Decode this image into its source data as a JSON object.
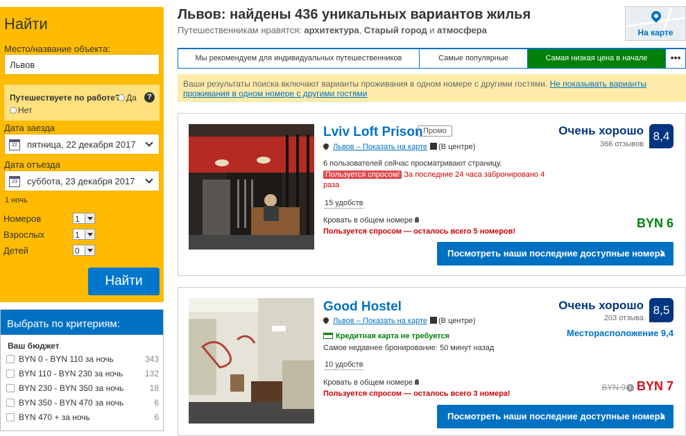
{
  "search": {
    "title": "Найти",
    "destination_label": "Место/название объекта:",
    "destination_value": "Львов",
    "business_trip_question": "Путешествуете по работе?",
    "business_trip_yes": "Да",
    "business_trip_no": "Нет",
    "checkin_label": "Дата заезда",
    "checkin_value": "пятница, 22 декабря 2017",
    "checkin_day": "22",
    "checkout_label": "Дата отъезда",
    "checkout_value": "суббота, 23 декабря 2017",
    "checkout_day": "23",
    "nights": "1 ночь",
    "rooms_label": "Номеров",
    "rooms_value": "1",
    "adults_label": "Взрослых",
    "adults_value": "1",
    "children_label": "Детей",
    "children_value": "0",
    "submit_label": "Найти"
  },
  "filters": {
    "header": "Выбрать по критериям:",
    "budget_title": "Ваш бюджет",
    "budget": [
      {
        "label": "BYN 0 - BYN 110 за ночь",
        "count": "343"
      },
      {
        "label": "BYN 110 - BYN 230 за ночь",
        "count": "132"
      },
      {
        "label": "BYN 230 - BYN 350 за ночь",
        "count": "18"
      },
      {
        "label": "BYN 350 - BYN 470 за ночь",
        "count": "6"
      },
      {
        "label": "BYN 470 + за ночь",
        "count": "6"
      }
    ]
  },
  "results": {
    "title": "Львов: найдены 436 уникальных вариантов жилья",
    "subtitle_prefix": "Путешественникам нравятся:",
    "like1": "архитектура",
    "like2": "Старый город",
    "like_and": "и",
    "like3": "атмосфера",
    "map_label": "На карте"
  },
  "sort_tabs": [
    {
      "label": "Мы рекомендуем для индивидуальных путешественников"
    },
    {
      "label": "Самые популярные"
    },
    {
      "label": "Самая низкая цена в начале"
    },
    {
      "label": "•••"
    }
  ],
  "notice": {
    "text": "Ваши результаты поиска включают варианты проживания в одном номере с другими гостями.",
    "link": "Не показывать варианты проживания в одном номере с другими гостями"
  },
  "hotels": [
    {
      "name": "Lviv Loft Prison",
      "promo": "Промо",
      "location_link": "Львов – Показать на карте",
      "center": "(В центре)",
      "viewing": "6 пользователей сейчас просматривают страницу.",
      "demand_badge": "Пользуется спросом!",
      "booked_text": "За последние 24 часа забронировано 4 раза",
      "facilities": "15 удобств",
      "bed": "Кровать в общем номере",
      "hot": "Пользуется спросом — осталось всего 5 номеров!",
      "score_word": "Очень хорошо",
      "reviews": "366 отзывов",
      "score": "8,4",
      "price": "BYN 6",
      "cta": "Посмотреть наши последние доступные номера"
    },
    {
      "name": "Good Hostel",
      "location_link": "Львов – Показать на карте",
      "center": "(В центре)",
      "credit": "Кредитная карта не требуется",
      "last_booking": "Самое недавнее бронирование: 50 минут назад",
      "facilities": "10 удобств",
      "bed": "Кровать в общем номере",
      "hot": "Пользуется спросом — осталось всего 3 номера!",
      "score_word": "Очень хорошо",
      "reviews": "203 отзыва",
      "score": "8,5",
      "location_score": "Месторасположение 9,4",
      "old_price": "BYN 9",
      "price": "BYN 7",
      "cta": "Посмотреть наши последние доступные номера"
    }
  ]
}
